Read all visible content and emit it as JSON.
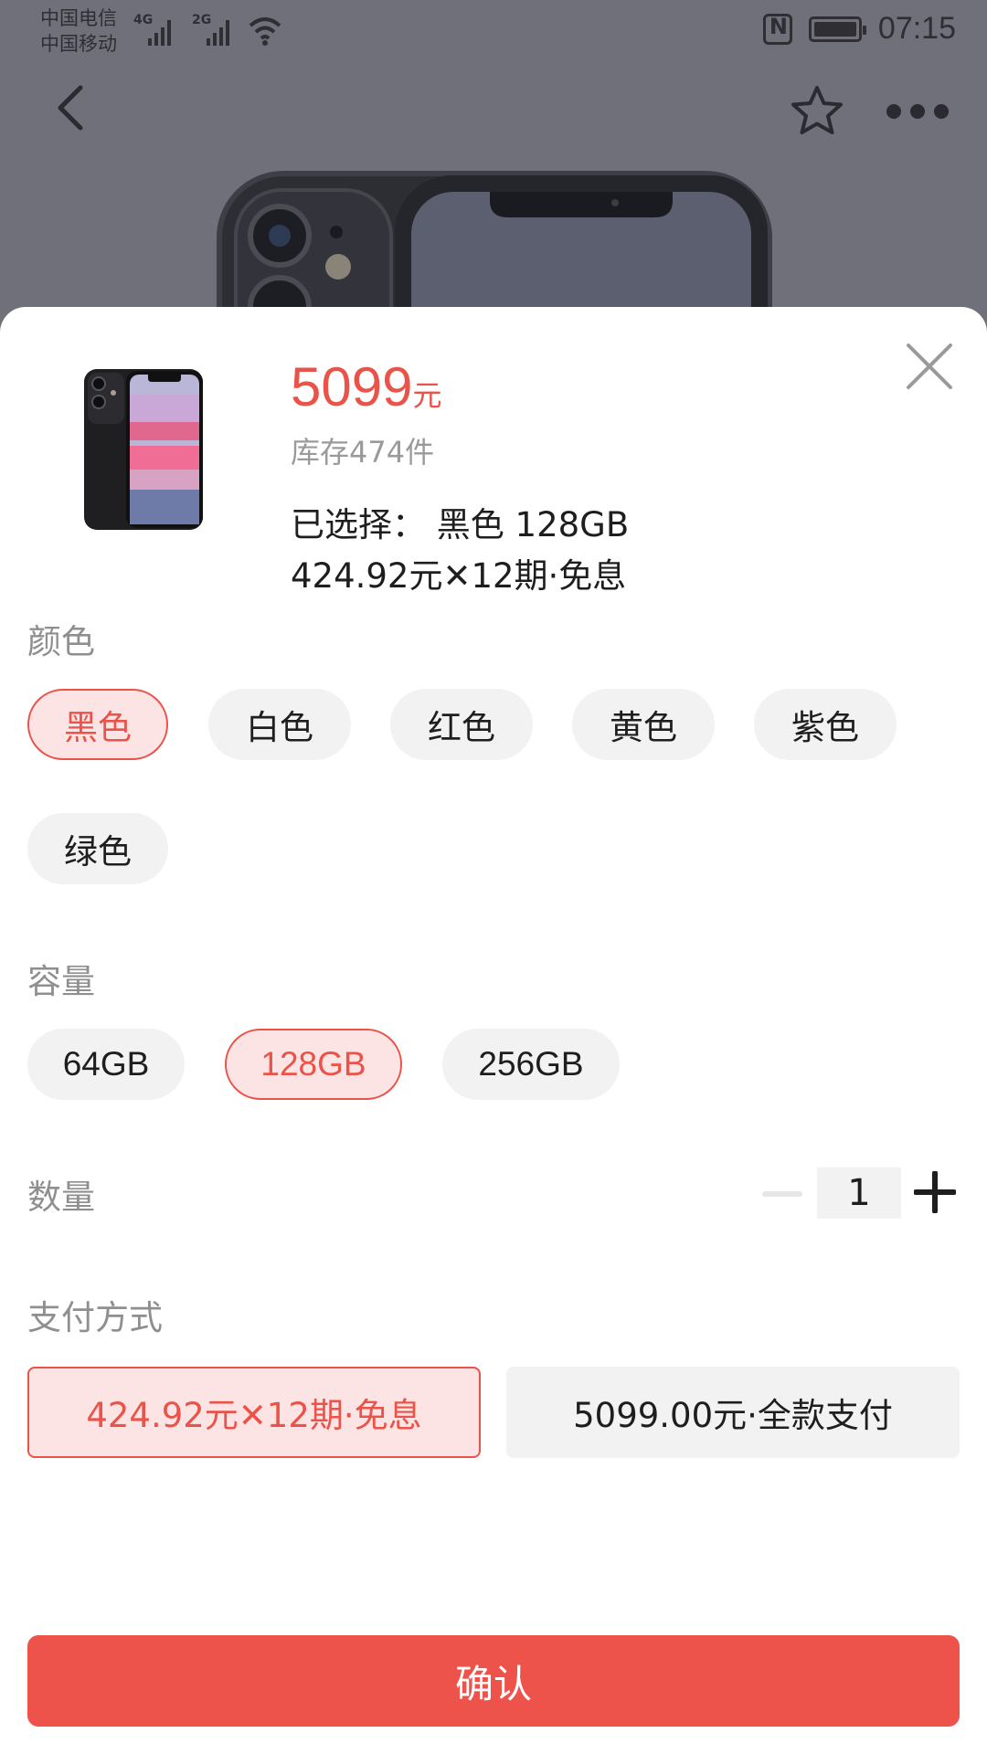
{
  "status_bar": {
    "carrier1": "中国电信",
    "carrier2": "中国移动",
    "net1": "4G",
    "net2": "2G",
    "time": "07:15"
  },
  "nav": {
    "back_icon": "chevron-left-icon",
    "favorite_icon": "star-outline-icon",
    "more_icon": "more-horizontal-icon"
  },
  "product": {
    "price": "5099",
    "price_unit": "元",
    "stock": "库存474件",
    "selected": "已选择：  黑色 128GB",
    "installment": "424.92元✕12期·免息"
  },
  "color": {
    "label": "颜色",
    "options": [
      "黑色",
      "白色",
      "红色",
      "黄色",
      "紫色",
      "绿色"
    ],
    "selected_index": 0
  },
  "capacity": {
    "label": "容量",
    "options": [
      "64GB",
      "128GB",
      "256GB"
    ],
    "selected_index": 1
  },
  "quantity": {
    "label": "数量",
    "value": "1"
  },
  "payment": {
    "label": "支付方式",
    "options": [
      "424.92元✕12期·免息",
      "5099.00元·全款支付"
    ],
    "selected_index": 0
  },
  "confirm_label": "确认",
  "colors": {
    "accent": "#ee534b",
    "accent_text": "#e95349",
    "chip_bg": "#f2f2f2",
    "chip_active_bg": "#fde4e4"
  }
}
